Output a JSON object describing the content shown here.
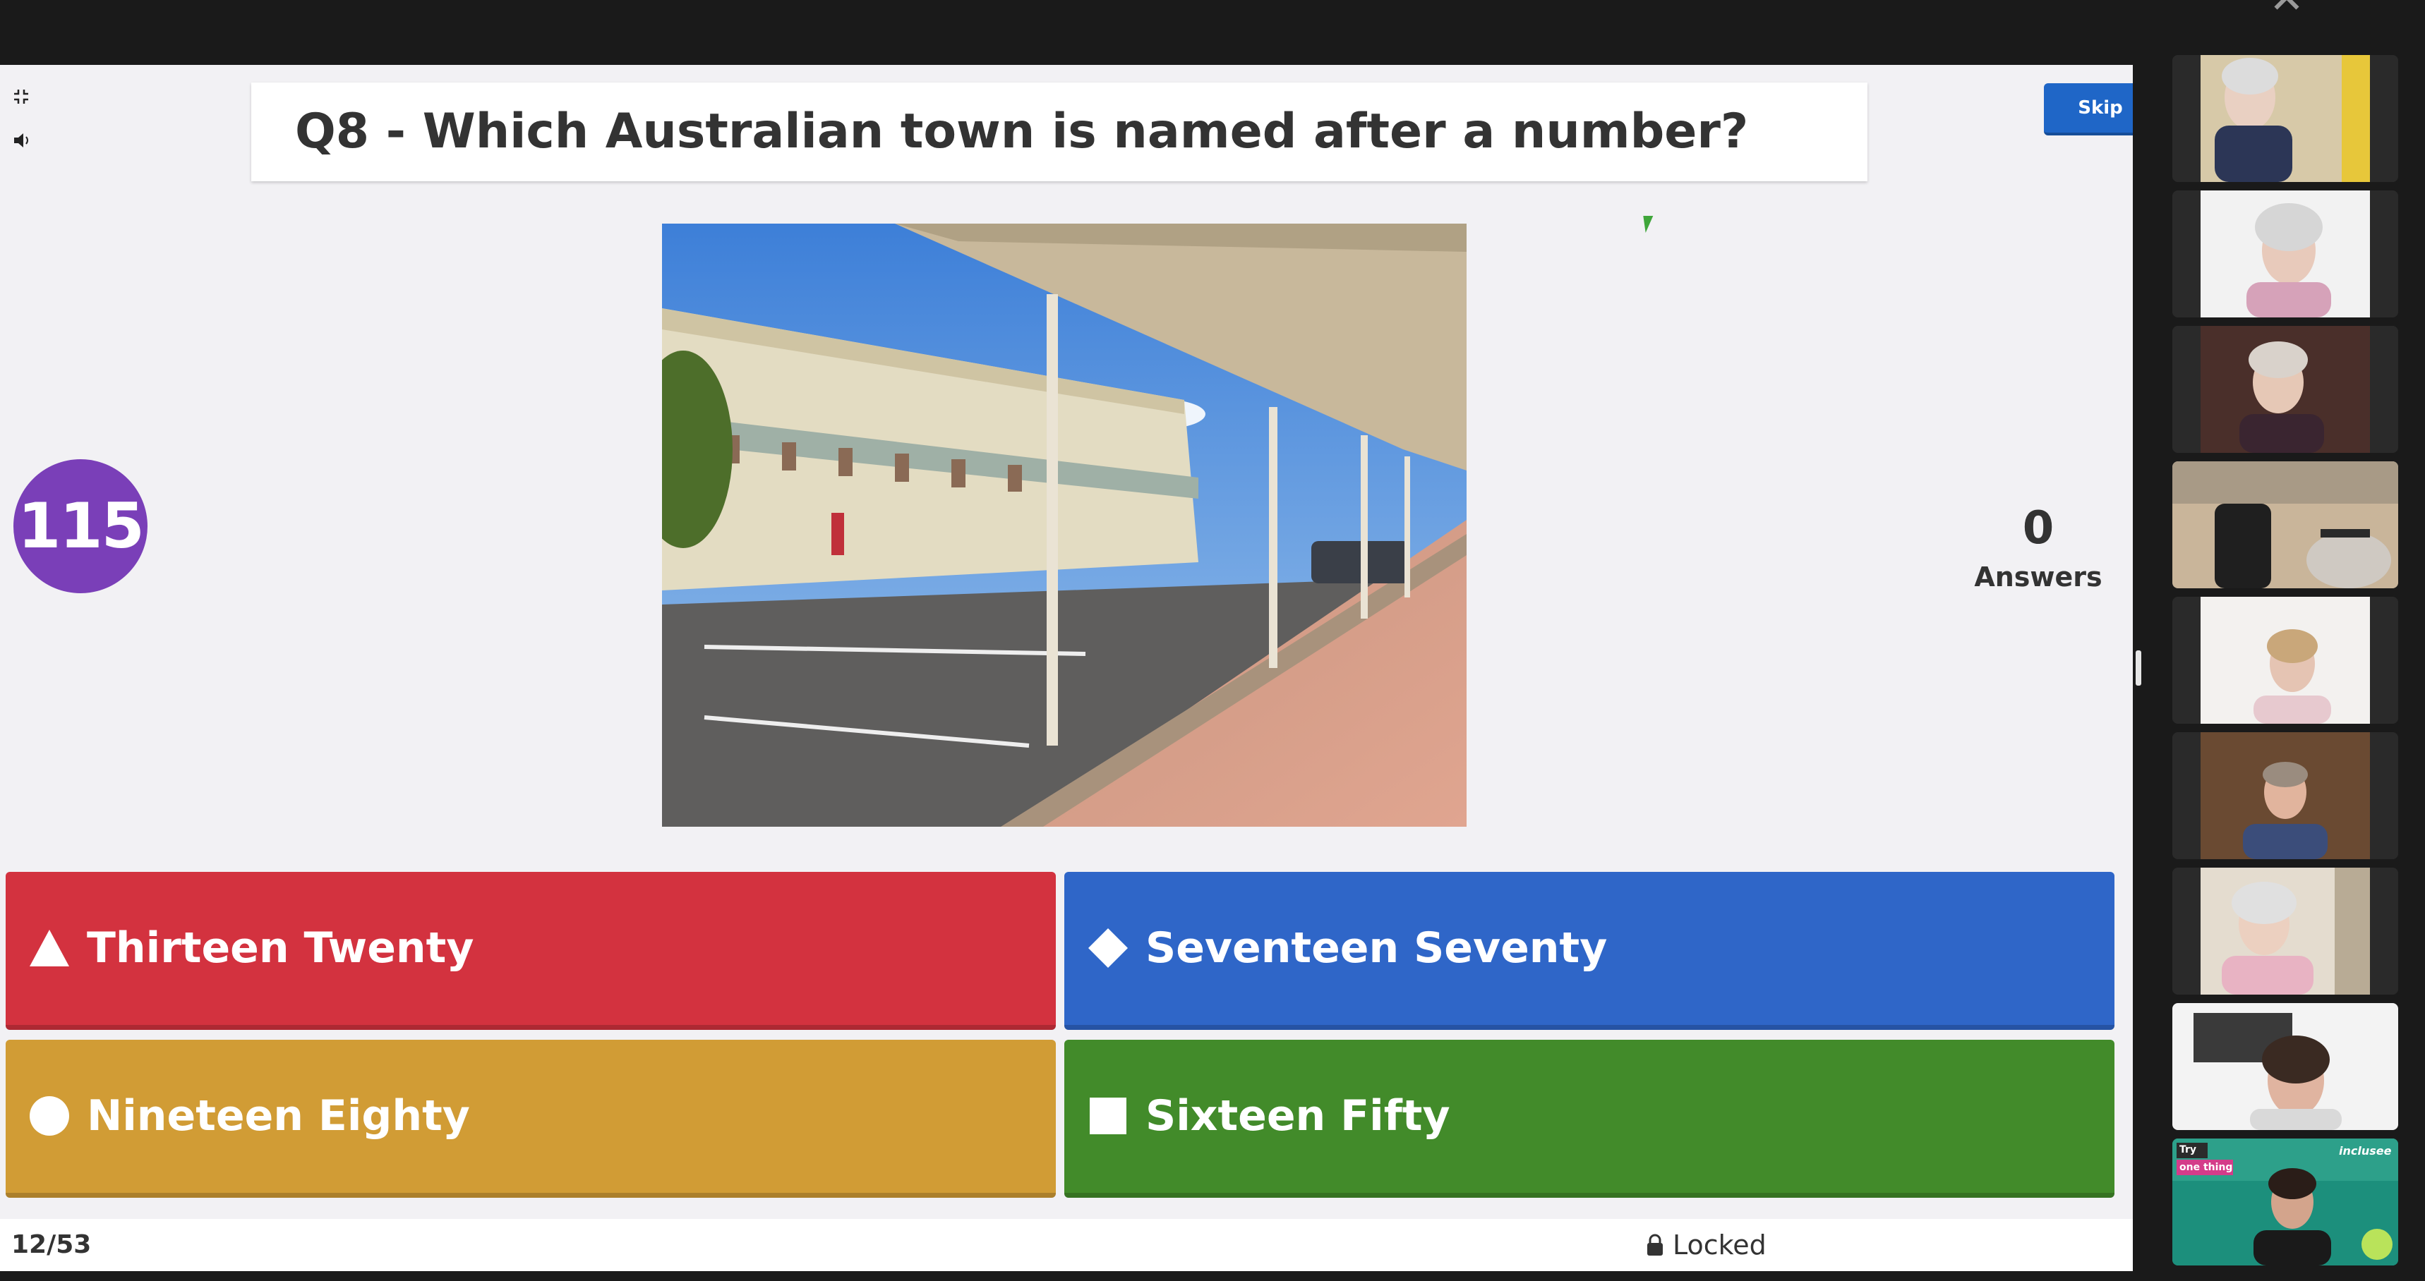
{
  "app": {
    "close_icon": "close-icon"
  },
  "quiz": {
    "question": "Q8 - Which Australian town is named after a number?",
    "skip_label": "Skip",
    "timer": "115",
    "answers_count": "0",
    "answers_label": "Answers",
    "options": [
      {
        "label": "Thirteen Twenty",
        "shape": "triangle-icon",
        "color": "#d3323f"
      },
      {
        "label": "Seventeen Seventy",
        "shape": "diamond-icon",
        "color": "#2f66c8"
      },
      {
        "label": "Nineteen Eighty",
        "shape": "circle-icon",
        "color": "#d19c35"
      },
      {
        "label": "Sixteen Fifty",
        "shape": "square-icon",
        "color": "#428b2a"
      }
    ],
    "progress": "12/53",
    "status": "Locked"
  },
  "participants_count": 9,
  "colors": {
    "accent_purple": "#7a3fb8",
    "skip_blue": "#1f66c8"
  },
  "promo": {
    "try": "Try",
    "one_thing": "one thing",
    "brand": "inclusee"
  }
}
